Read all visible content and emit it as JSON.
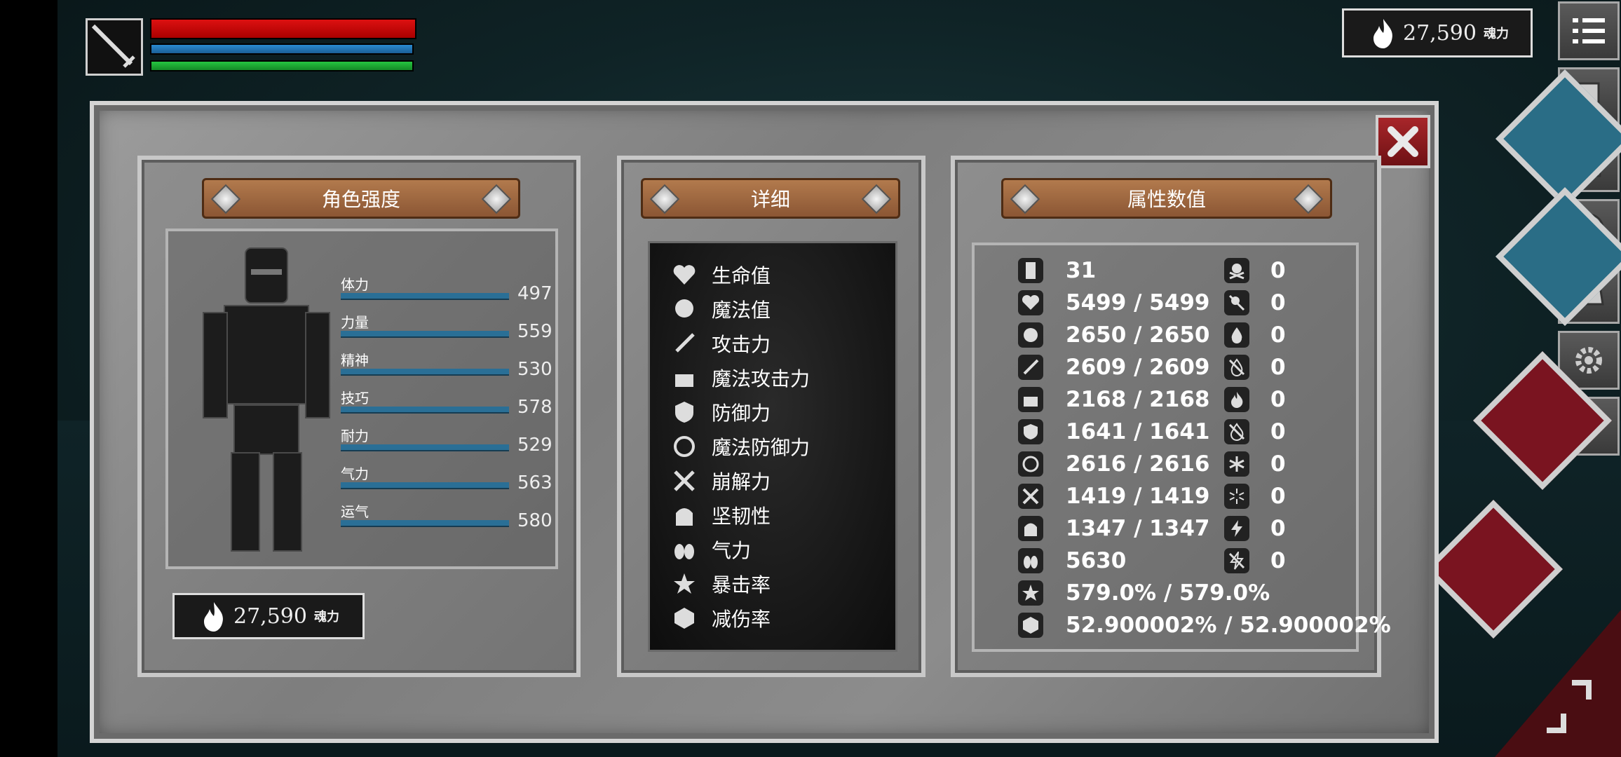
{
  "hud": {
    "soul_value": "27,590",
    "soul_unit": "魂力",
    "hp_color": "#cc1111",
    "mp_color": "#2a8ad0",
    "stamina_color": "#26c640"
  },
  "panel": {
    "left_title": "角色强度",
    "mid_title": "详细",
    "right_title": "属性数值"
  },
  "stats": [
    {
      "label": "体力",
      "value": "497"
    },
    {
      "label": "力量",
      "value": "559"
    },
    {
      "label": "精神",
      "value": "530"
    },
    {
      "label": "技巧",
      "value": "578"
    },
    {
      "label": "耐力",
      "value": "529"
    },
    {
      "label": "气力",
      "value": "563"
    },
    {
      "label": "运气",
      "value": "580"
    }
  ],
  "bottom_soul": {
    "value": "27,590",
    "unit": "魂力"
  },
  "details": [
    {
      "icon": "heart-icon",
      "label": "生命值"
    },
    {
      "icon": "head-icon",
      "label": "魔法值"
    },
    {
      "icon": "sword-icon",
      "label": "攻击力"
    },
    {
      "icon": "magic-attack-icon",
      "label": "魔法攻击力"
    },
    {
      "icon": "shield-icon",
      "label": "防御力"
    },
    {
      "icon": "magic-defense-icon",
      "label": "魔法防御力"
    },
    {
      "icon": "break-icon",
      "label": "崩解力"
    },
    {
      "icon": "helmet-icon",
      "label": "坚韧性"
    },
    {
      "icon": "lungs-icon",
      "label": "气力"
    },
    {
      "icon": "crit-icon",
      "label": "暴击率"
    },
    {
      "icon": "reduce-icon",
      "label": "减伤率"
    }
  ],
  "attributes": [
    {
      "icon": "level-icon",
      "value": "31"
    },
    {
      "icon": "heart-icon",
      "value": "5499 / 5499"
    },
    {
      "icon": "head-icon",
      "value": "2650 / 2650"
    },
    {
      "icon": "sword-icon",
      "value": "2609 / 2609"
    },
    {
      "icon": "magic-attack-icon",
      "value": "2168 / 2168"
    },
    {
      "icon": "shield-icon",
      "value": "1641 / 1641"
    },
    {
      "icon": "magic-defense-icon",
      "value": "2616 / 2616"
    },
    {
      "icon": "break-icon",
      "value": "1419 / 1419"
    },
    {
      "icon": "helmet-icon",
      "value": "1347 / 1347"
    },
    {
      "icon": "lungs-icon",
      "value": "5630"
    },
    {
      "icon": "crit-icon",
      "value": "579.0% / 579.0%"
    },
    {
      "icon": "reduce-icon",
      "value": "52.900002% / 52.900002%"
    }
  ],
  "resistances": [
    {
      "icon": "skull-icon",
      "value": "0"
    },
    {
      "icon": "skull-crossed-icon",
      "value": "0"
    },
    {
      "icon": "blood-drop-icon",
      "value": "0"
    },
    {
      "icon": "blood-crossed-icon",
      "value": "0"
    },
    {
      "icon": "fire-icon",
      "value": "0"
    },
    {
      "icon": "fire-crossed-icon",
      "value": "0"
    },
    {
      "icon": "frost-icon",
      "value": "0"
    },
    {
      "icon": "frost-crossed-icon",
      "value": "0"
    },
    {
      "icon": "lightning-icon",
      "value": "0"
    },
    {
      "icon": "lightning-crossed-icon",
      "value": "0"
    }
  ]
}
